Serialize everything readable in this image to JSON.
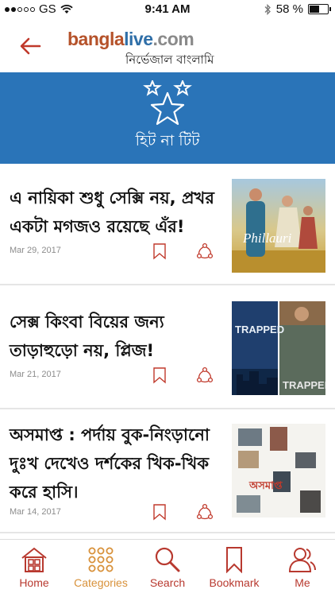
{
  "status_bar": {
    "carrier": "GS",
    "time": "9:41 AM",
    "battery": "58 %",
    "battery_level": 0.58
  },
  "header": {
    "logo": {
      "part1": "bang",
      "part2": "la",
      "part3": "live",
      "part4": ".com",
      "tagline": "নির্ভেজাল বাংলামি"
    }
  },
  "banner": {
    "title": "হিট না টিট"
  },
  "articles": [
    {
      "headline": "এ নায়িকা শুধু সেক্সি নয়, প্রখর একটা মগজও রয়েছে এঁর!",
      "date": "Mar 29, 2017",
      "thumb_caption": "Phillauri"
    },
    {
      "headline": "সেক্স কিংবা বিয়ের জন্য তাড়াহুড়ো নয়, প্লিজ!",
      "date": "Mar 21, 2017",
      "thumb_caption": "TRAPPED"
    },
    {
      "headline": "অসমাপ্ত : পর্দায় বুক-নিংড়ানো দুঃখ দেখেও দর্শকের খিক-খিক করে হাসি।",
      "date": "Mar 14, 2017",
      "thumb_caption": "অসমাপ্ত"
    }
  ],
  "tabs": [
    {
      "label": "Home",
      "icon": "home-icon"
    },
    {
      "label": "Categories",
      "icon": "categories-icon"
    },
    {
      "label": "Search",
      "icon": "search-icon"
    },
    {
      "label": "Bookmark",
      "icon": "bookmark-icon"
    },
    {
      "label": "Me",
      "icon": "user-icon"
    }
  ],
  "colors": {
    "brand_red": "#c0392b",
    "banner_blue": "#2a74b8",
    "active_tab": "#d8913a"
  }
}
